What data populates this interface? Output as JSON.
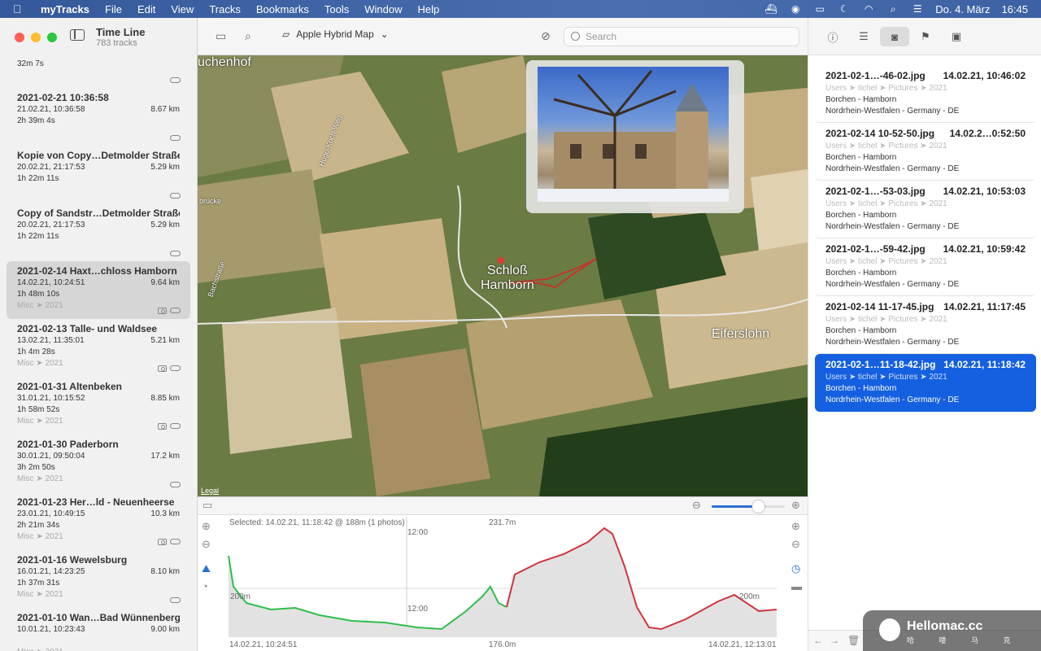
{
  "menubar": {
    "apple": "",
    "app": "myTracks",
    "items": [
      "File",
      "Edit",
      "View",
      "Tracks",
      "Bookmarks",
      "Tools",
      "Window",
      "Help"
    ],
    "date": "Do. 4. März",
    "time": "16:45"
  },
  "sidebar": {
    "title": "Time Line",
    "subtitle": "783 tracks",
    "first_duration": "32m 7s",
    "tracks": [
      {
        "name": "2021-02-21 10:36:58",
        "date": "21.02.21, 10:36:58",
        "distance": "8.67 km",
        "duration": "2h 39m 4s",
        "category": "",
        "photos": false
      },
      {
        "name": "Kopie von Copy…Detmolder Straße",
        "date": "20.02.21, 21:17:53",
        "distance": "5.29 km",
        "duration": "1h 22m 11s",
        "category": "",
        "photos": false
      },
      {
        "name": "Copy of Sandstr…Detmolder Straße",
        "date": "20.02.21, 21:17:53",
        "distance": "5.29 km",
        "duration": "1h 22m 11s",
        "category": "",
        "photos": false
      },
      {
        "name": "2021-02-14 Haxt…chloss Hamborn",
        "date": "14.02.21, 10:24:51",
        "distance": "9.64 km",
        "duration": "1h 48m 10s",
        "category": "Misc ➤ 2021",
        "photos": true
      },
      {
        "name": "2021-02-13 Talle- und Waldsee",
        "date": "13.02.21, 11:35:01",
        "distance": "5.21 km",
        "duration": "1h 4m 28s",
        "category": "Misc ➤ 2021",
        "photos": true
      },
      {
        "name": "2021-01-31 Altenbeken",
        "date": "31.01.21, 10:15:52",
        "distance": "8.85 km",
        "duration": "1h 58m 52s",
        "category": "Misc ➤ 2021",
        "photos": true
      },
      {
        "name": "2021-01-30 Paderborn",
        "date": "30.01.21, 09:50:04",
        "distance": "17.2 km",
        "duration": "3h 2m 50s",
        "category": "Misc ➤ 2021",
        "photos": false
      },
      {
        "name": "2021-01-23 Her…ld - Neuenheerse",
        "date": "23.01.21, 10:49:15",
        "distance": "10.3 km",
        "duration": "2h 21m 34s",
        "category": "Misc ➤ 2021",
        "photos": true
      },
      {
        "name": "2021-01-16 Wewelsburg",
        "date": "16.01.21, 14:23:25",
        "distance": "8.10 km",
        "duration": "1h 37m 31s",
        "category": "Misc ➤ 2021",
        "photos": false
      },
      {
        "name": "2021-01-10 Wan…Bad Wünnenberg",
        "date": "10.01.21, 10:23:43",
        "distance": "9.00 km",
        "duration": "",
        "category": "Misc ➤ 2021",
        "photos": true
      }
    ]
  },
  "toolbar": {
    "map_type": "Apple Hybrid Map",
    "search_placeholder": "Search"
  },
  "map": {
    "labels": [
      "uchenhof",
      "Schloß",
      "Hamborn",
      "Eiferslohn",
      "Hugo-Koch-Weg",
      "brücke",
      "Bachstraße"
    ],
    "legal": "Legal"
  },
  "chart": {
    "selected": "Selected: 14.02.21, 11:18:42 @ 188m (1 photos)",
    "max_label": "231.7m",
    "time_label_1": "12:00",
    "time_label_2": "12:00",
    "elev_left": "200m",
    "elev_right": "200m",
    "start": "14.02.21, 10:24:51",
    "mid": "176.0m",
    "end": "14.02.21, 12:13:01"
  },
  "photos": [
    {
      "name": "2021-02-1…-46-02.jpg",
      "time": "14.02.21, 10:46:02",
      "path": "Users ➤ tichel ➤ Pictures ➤ 2021",
      "place": "Borchen - Hamborn",
      "region": "Nordrhein-Westfalen - Germany - DE"
    },
    {
      "name": "2021-02-14 10-52-50.jpg",
      "time": "14.02.2…0:52:50",
      "path": "Users ➤ tichel ➤ Pictures ➤ 2021",
      "place": "Borchen - Hamborn",
      "region": "Nordrhein-Westfalen - Germany - DE"
    },
    {
      "name": "2021-02-1…-53-03.jpg",
      "time": "14.02.21, 10:53:03",
      "path": "Users ➤ tichel ➤ Pictures ➤ 2021",
      "place": "Borchen - Hamborn",
      "region": "Nordrhein-Westfalen - Germany - DE"
    },
    {
      "name": "2021-02-1…-59-42.jpg",
      "time": "14.02.21, 10:59:42",
      "path": "Users ➤ tichel ➤ Pictures ➤ 2021",
      "place": "Borchen - Hamborn",
      "region": "Nordrhein-Westfalen - Germany - DE"
    },
    {
      "name": "2021-02-14 11-17-45.jpg",
      "time": "14.02.21, 11:17:45",
      "path": "Users ➤ tichel ➤ Pictures ➤ 2021",
      "place": "Borchen - Hamborn",
      "region": "Nordrhein-Westfalen - Germany - DE"
    },
    {
      "name": "2021-02-1…11-18-42.jpg",
      "time": "14.02.21, 11:18:42",
      "path": "Users ➤ tichel ➤ Pictures ➤ 2021",
      "place": "Borchen - Hamborn",
      "region": "Nordrhein-Westfalen - Germany - DE"
    }
  ],
  "watermark": {
    "title": "Hellomac.cc",
    "subtitle": "哈 喽 马 克"
  }
}
